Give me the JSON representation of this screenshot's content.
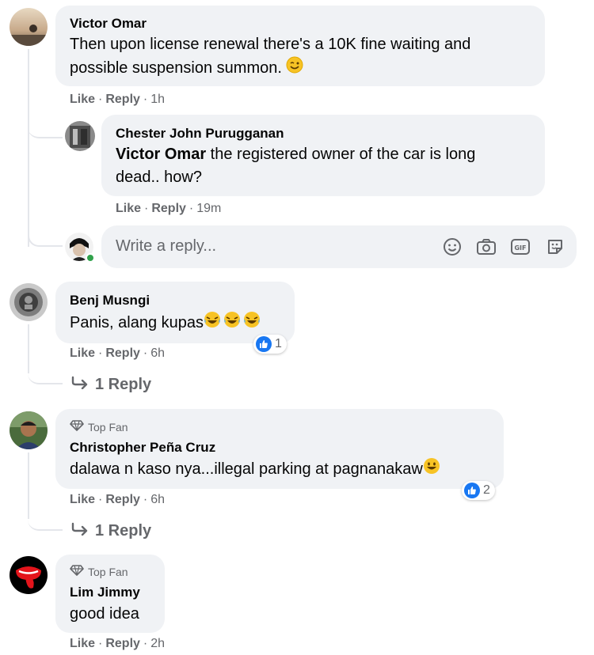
{
  "comments": [
    {
      "author": "Victor Omar",
      "text_line1": "Then upon license renewal there's a 10K fine waiting and",
      "text_line2": "possible suspension summon.",
      "emoji": "wink",
      "like": "Like",
      "reply": "Reply",
      "time": "1h",
      "replies": [
        {
          "author": "Chester John Purugganan",
          "mention": "Victor Omar",
          "text_line1_rest": " the registered owner of the car is long",
          "text_line2": "dead.. how?",
          "like": "Like",
          "reply": "Reply",
          "time": "19m"
        }
      ],
      "reply_input": {
        "placeholder": "Write a reply..."
      }
    },
    {
      "author": "Benj Musngi",
      "text": "Panis, alang kupas",
      "emoji": "laugh x3",
      "reaction_count": "1",
      "like": "Like",
      "reply": "Reply",
      "time": "6h",
      "view_replies": "1 Reply"
    },
    {
      "badge": "Top Fan",
      "author": "Christopher Peña Cruz",
      "text": "dalawa n kaso nya...illegal parking at pagnanakaw",
      "emoji": "grin",
      "reaction_count": "2",
      "like": "Like",
      "reply": "Reply",
      "time": "6h",
      "view_replies": "1 Reply"
    },
    {
      "badge": "Top Fan",
      "author": "Lim Jimmy",
      "text": "good idea",
      "like": "Like",
      "reply": "Reply",
      "time": "2h"
    }
  ],
  "icons": [
    "emoji-icon",
    "camera-icon",
    "gif-icon",
    "sticker-icon",
    "diamond-icon",
    "reply-arrow-icon",
    "like-reaction-icon"
  ],
  "colors": {
    "bubble": "#f0f2f5",
    "meta": "#65676b",
    "like_blue": "#1877f2",
    "online_green": "#31a24c"
  }
}
